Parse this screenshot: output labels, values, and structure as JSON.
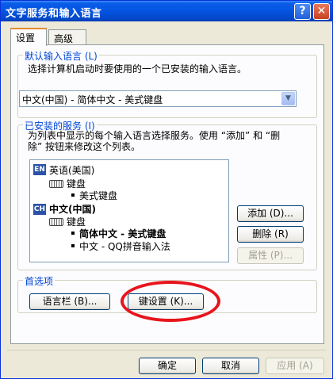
{
  "window": {
    "title": "文字服务和输入语言",
    "help_glyph": "?",
    "close_glyph": "✕"
  },
  "tabs": [
    {
      "label": "设置",
      "active": true
    },
    {
      "label": "高级",
      "active": false
    }
  ],
  "default_language": {
    "legend": "默认输入语言 (L)",
    "description": "选择计算机启动时要使用的一个已安装的输入语言。",
    "selected": "中文(中国) - 简体中文 - 美式键盘"
  },
  "installed_services": {
    "legend": "已安装的服务 (I)",
    "description_line1": "为列表中显示的每个输入语言选择服务。使用 “添加” 和 “删",
    "description_line2": "除” 按钮来修改这个列表。",
    "tree": {
      "lang1": {
        "badge": "EN",
        "label": "英语(美国)",
        "category": "键盘",
        "item": "美式键盘"
      },
      "lang2": {
        "badge": "CH",
        "label": "中文(中国)",
        "category": "键盘",
        "item1": "简体中文 - 美式键盘",
        "item2": "中文 - QQ拼音输入法"
      }
    },
    "add_button": "添加 (D)...",
    "remove_button": "删除 (R)",
    "properties_button": "属性 (P)..."
  },
  "preferences": {
    "legend": "首选项",
    "language_bar_button": "语言栏 (B)...",
    "key_settings_button": "键设置 (K)..."
  },
  "footer": {
    "ok_button": "确定",
    "cancel_button": "取消",
    "apply_button": "应用 (A)"
  },
  "colors": {
    "titlebar": "#0454e0",
    "dialog_bg": "#ece9d8",
    "legend_text": "#0046d5",
    "annotation_ring": "#e8141c"
  }
}
